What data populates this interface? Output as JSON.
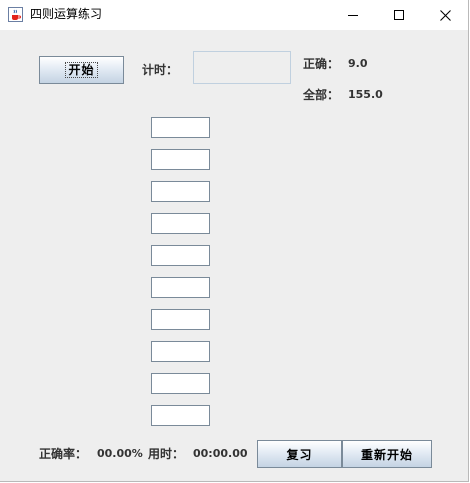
{
  "window": {
    "title": "四则运算练习"
  },
  "controls": {
    "start_label": "开始",
    "timer_label": "计时：",
    "timer_value": "",
    "review_label": "复习",
    "restart_label": "重新开始"
  },
  "stats": {
    "correct_label": "正确：",
    "correct_value": "9.0",
    "total_label": "全部：",
    "total_value": "155.0",
    "accuracy_label": "正确率：",
    "accuracy_value": "00.00%",
    "time_used_label": "用时：",
    "time_used_value": "00:00.00"
  },
  "answers": [
    "",
    "",
    "",
    "",
    "",
    "",
    "",
    "",
    "",
    ""
  ],
  "icons": {
    "app": "java-cup-icon",
    "minimize": "minimize-icon",
    "maximize": "maximize-icon",
    "close": "close-icon"
  }
}
